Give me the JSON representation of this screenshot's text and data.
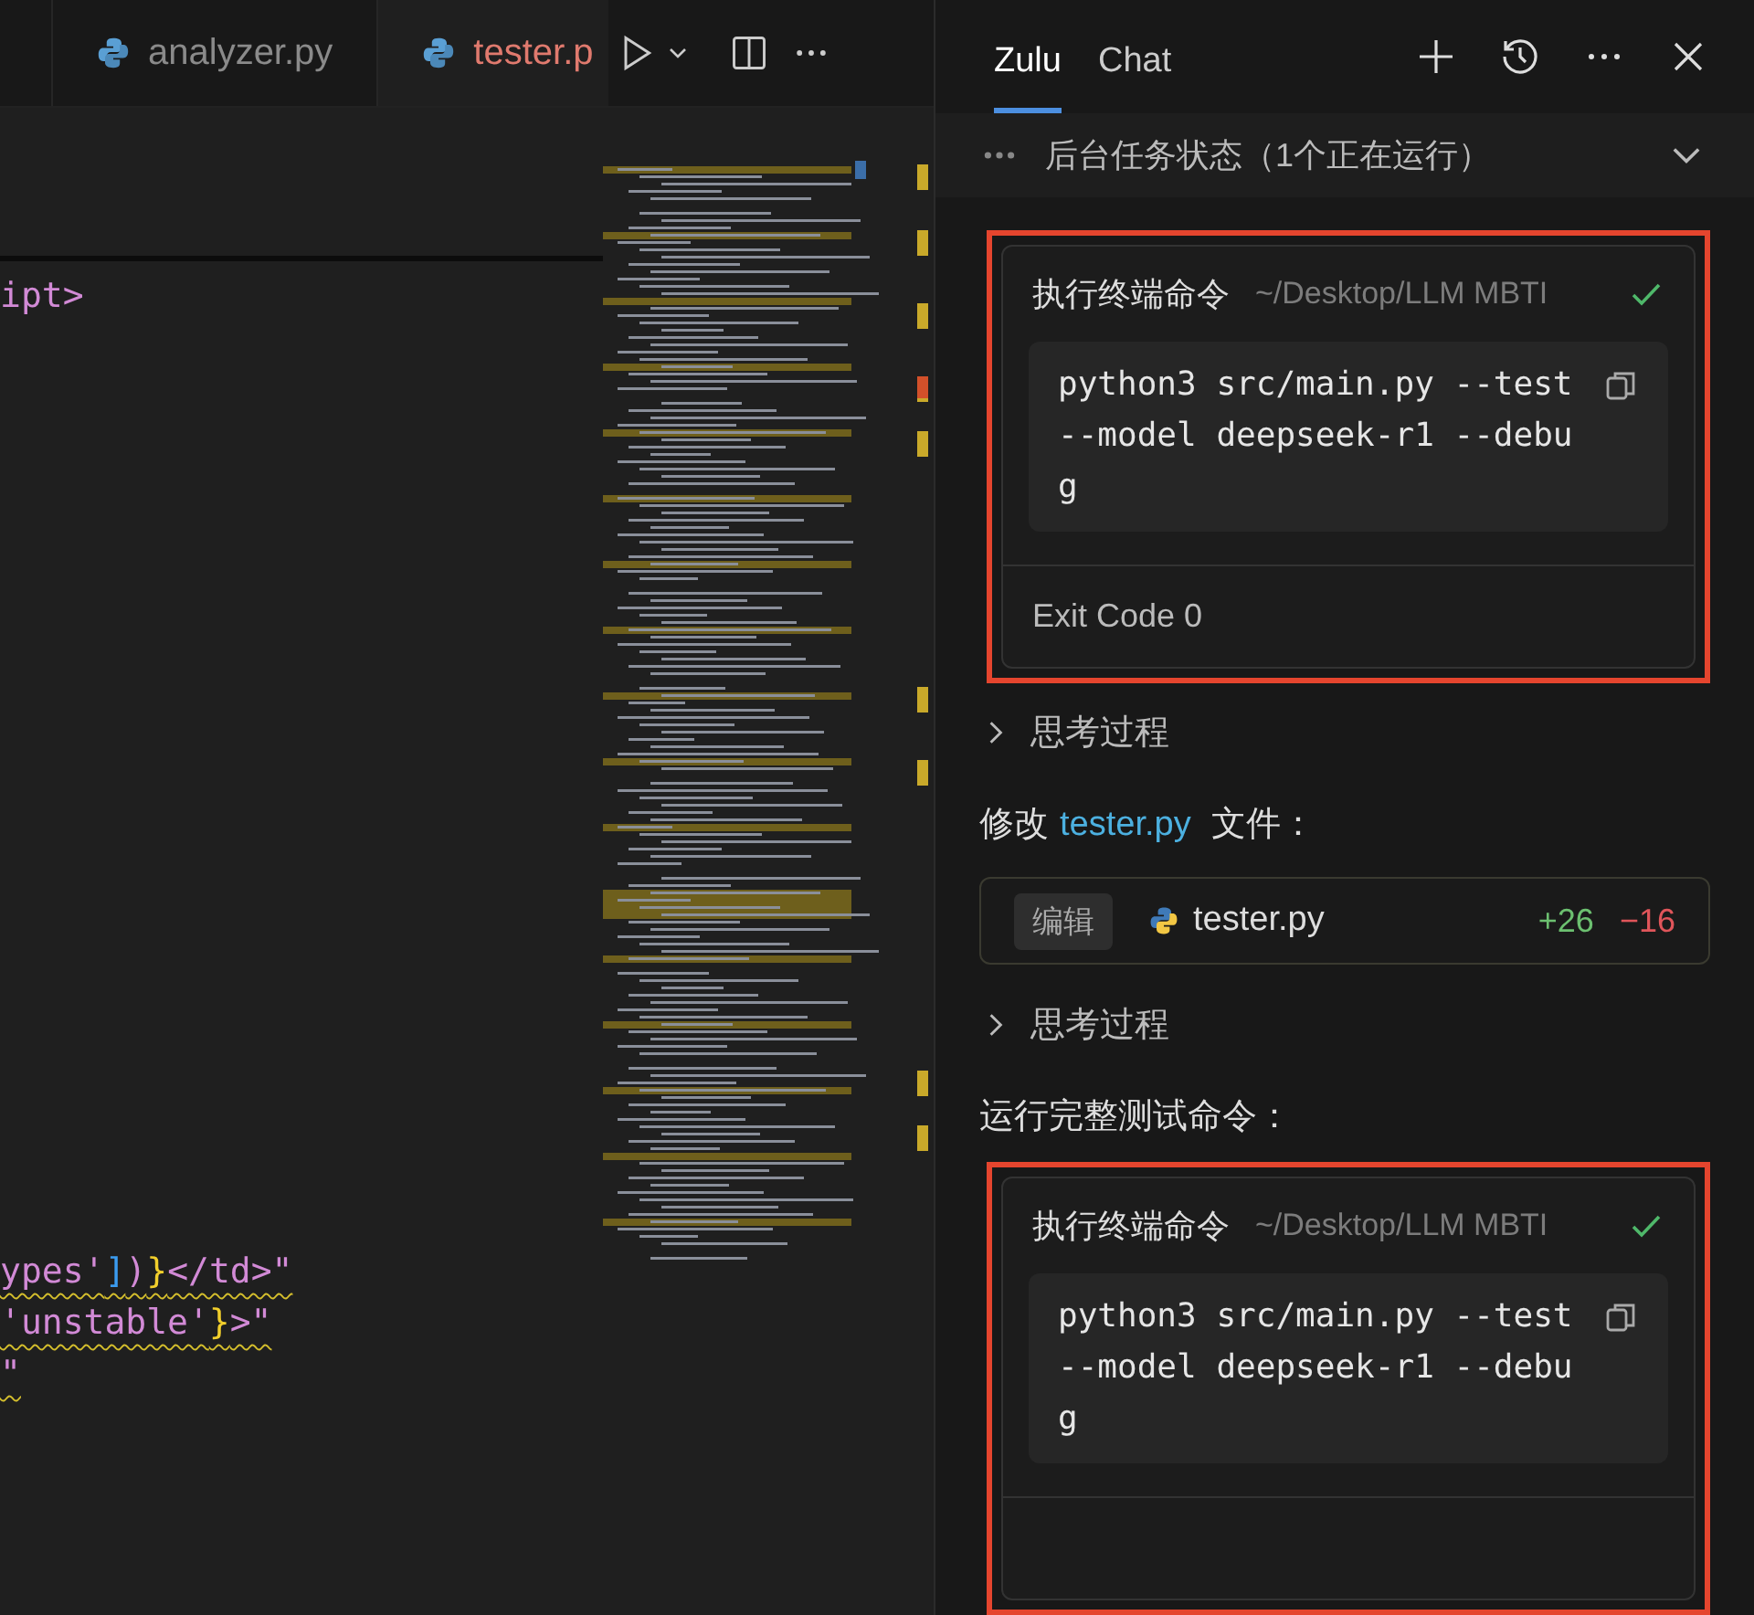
{
  "editor": {
    "tabs": [
      {
        "label": "analyzer.py",
        "selected": false,
        "modified": false
      },
      {
        "label": "tester.p",
        "selected": true,
        "modified": true
      }
    ],
    "top_lines": [
      {
        "squiggle": false,
        "tokens": [
          {
            "kind": "text",
            "text": "ipt>"
          }
        ]
      }
    ],
    "bottom_lines": [
      {
        "squiggle": true,
        "tokens": [
          {
            "kind": "text",
            "text": "ypes'"
          },
          {
            "kind": "bracket",
            "text": "]"
          },
          {
            "kind": "text",
            "text": ")"
          },
          {
            "kind": "brace",
            "text": "}"
          },
          {
            "kind": "text",
            "text": "</td>\""
          }
        ]
      },
      {
        "squiggle": true,
        "tokens": [
          {
            "kind": "text",
            "text": "'unstable'"
          },
          {
            "kind": "brace",
            "text": "}"
          },
          {
            "kind": "text",
            "text": ">\""
          }
        ]
      },
      {
        "squiggle": true,
        "tokens": [
          {
            "kind": "text",
            "text": "\""
          }
        ]
      }
    ]
  },
  "panel": {
    "tabs": [
      {
        "label": "Zulu",
        "selected": true
      },
      {
        "label": "Chat",
        "selected": false
      }
    ],
    "task_bar": {
      "label": "后台任务状态（1个正在运行）",
      "expanded": false
    },
    "items": [
      {
        "kind": "command",
        "highlighted": true,
        "title": "执行终端命令",
        "path": "~/Desktop/LLM MBTI",
        "done": true,
        "command": "python3 src/main.py --test --model deepseek-r1 --debug",
        "footer": "Exit Code 0"
      },
      {
        "kind": "thinking",
        "label": "思考过程",
        "expanded": false
      },
      {
        "kind": "text",
        "before": "修改",
        "link": "tester.py",
        "after": "文件："
      },
      {
        "kind": "edit",
        "badge": "编辑",
        "file": "tester.py",
        "added": "+26",
        "removed": "−16"
      },
      {
        "kind": "thinking",
        "label": "思考过程",
        "expanded": false
      },
      {
        "kind": "text",
        "before": "运行完整测试命令："
      },
      {
        "kind": "command",
        "highlighted": true,
        "title": "执行终端命令",
        "path": "~/Desktop/LLM MBTI",
        "done": true,
        "command": "python3 src/main.py --test --model deepseek-r1 --debug"
      }
    ]
  }
}
